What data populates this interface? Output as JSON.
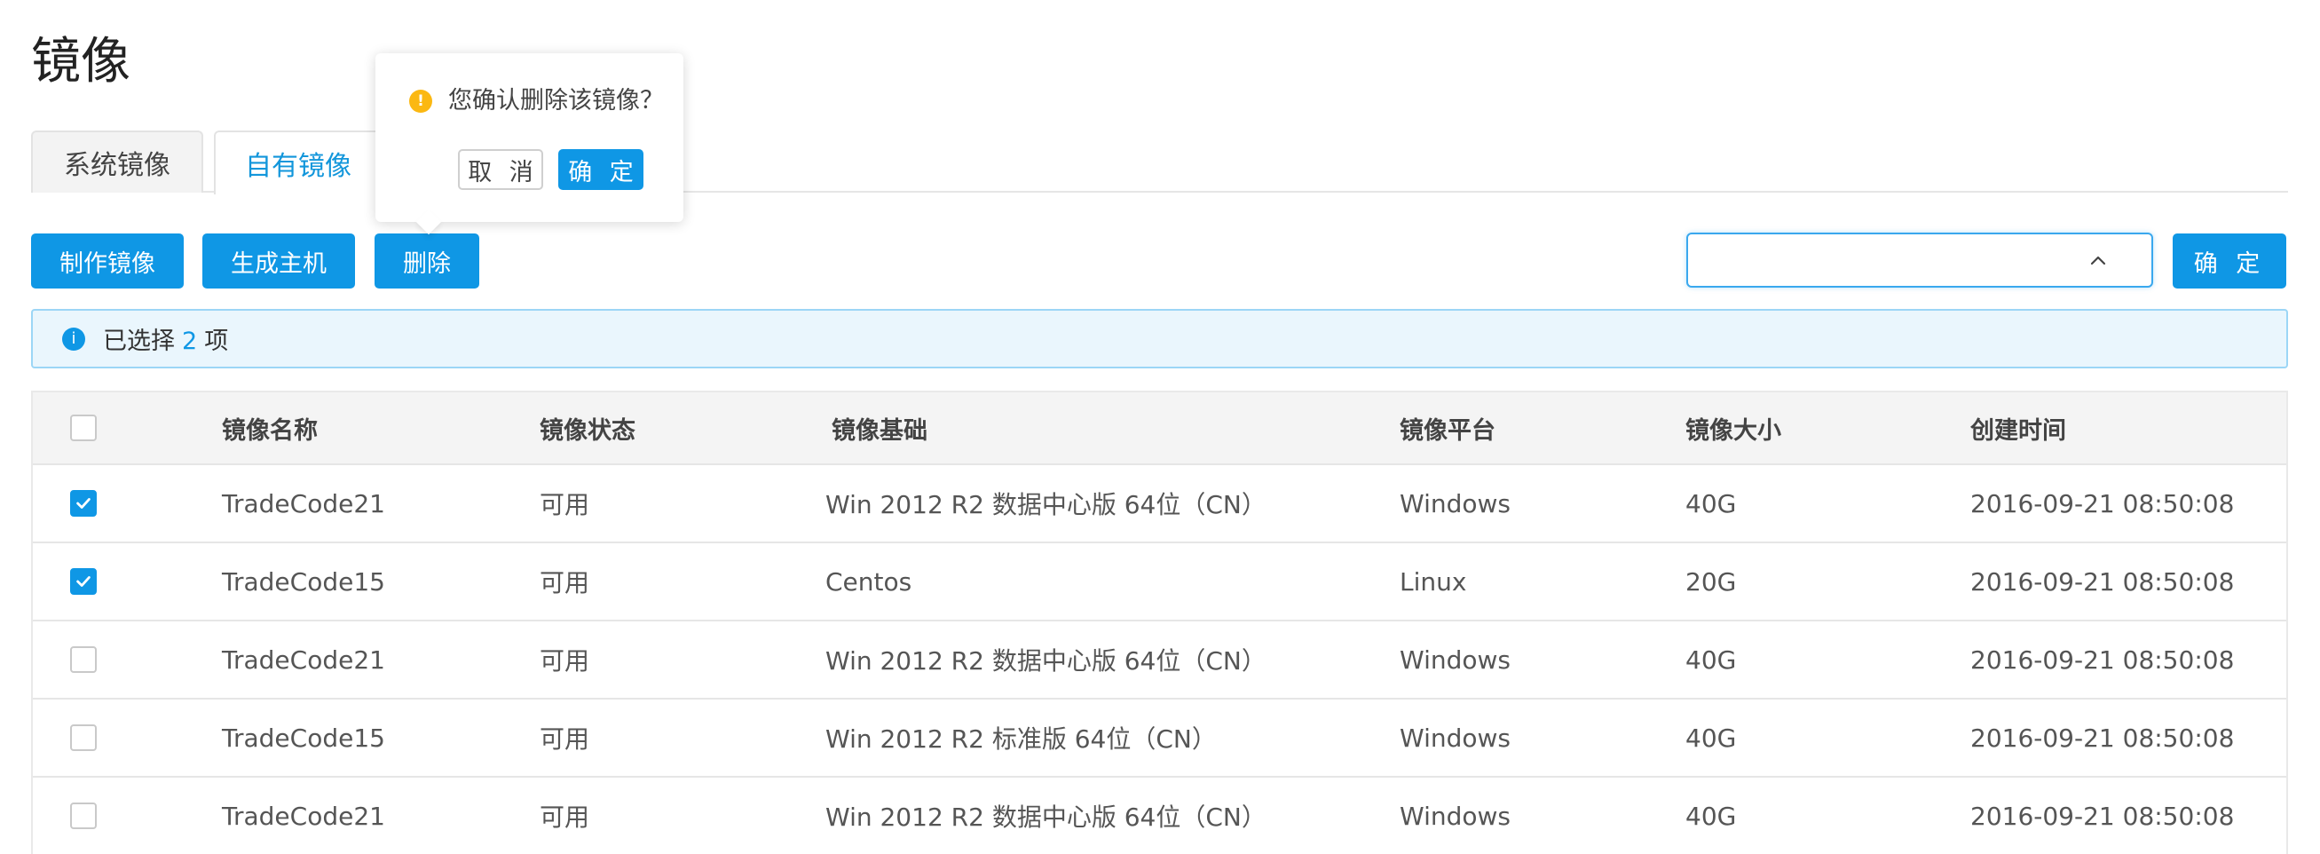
{
  "page": {
    "title": "镜像"
  },
  "tabs": [
    {
      "label": "系统镜像",
      "active": false
    },
    {
      "label": "自有镜像",
      "active": true
    }
  ],
  "toolbar": {
    "make_label": "制作镜像",
    "generate_label": "生成主机",
    "delete_label": "删除",
    "select_value": "",
    "confirm_label": "确 定"
  },
  "popconfirm": {
    "question": "您确认删除该镜像？",
    "cancel_label": "取 消",
    "ok_label": "确 定",
    "icon": "warning-icon"
  },
  "alert": {
    "prefix": "已选择",
    "count": "2",
    "suffix": "项",
    "icon": "info-icon"
  },
  "table": {
    "headers": [
      "镜像名称",
      "镜像状态",
      "镜像基础",
      "镜像平台",
      "镜像大小",
      "创建时间"
    ],
    "rows": [
      {
        "checked": true,
        "name": "TradeCode21",
        "status": "可用",
        "base": "Win 2012 R2 数据中心版 64位（CN）",
        "platform": "Windows",
        "size": "40G",
        "created": "2016-09-21  08:50:08"
      },
      {
        "checked": true,
        "name": "TradeCode15",
        "status": "可用",
        "base": "Centos",
        "platform": "Linux",
        "size": "20G",
        "created": "2016-09-21  08:50:08"
      },
      {
        "checked": false,
        "name": "TradeCode21",
        "status": "可用",
        "base": "Win 2012 R2 数据中心版 64位（CN）",
        "platform": "Windows",
        "size": "40G",
        "created": "2016-09-21  08:50:08"
      },
      {
        "checked": false,
        "name": "TradeCode15",
        "status": "可用",
        "base": "Win 2012 R2 标准版 64位（CN）",
        "platform": "Windows",
        "size": "40G",
        "created": "2016-09-21  08:50:08"
      },
      {
        "checked": false,
        "name": "TradeCode21",
        "status": "可用",
        "base": "Win 2012 R2 数据中心版 64位（CN）",
        "platform": "Windows",
        "size": "40G",
        "created": "2016-09-21  08:50:08"
      }
    ]
  },
  "colors": {
    "primary": "#0f97e5",
    "active_tab_text": "#1296db",
    "warning": "#fbb812",
    "alert_bg": "#eaf6fd"
  }
}
